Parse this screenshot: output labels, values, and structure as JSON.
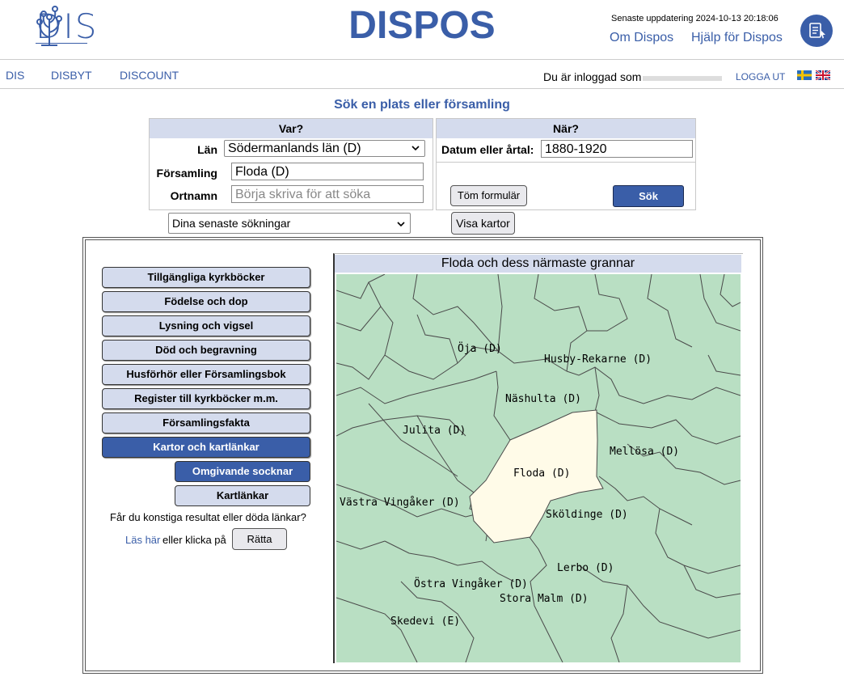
{
  "header": {
    "logo_text": "DIS",
    "title": "DISPOS",
    "updated": "Senaste uppdatering 2024-10-13 20:18:06",
    "links": [
      "Om Dispos",
      "Hjälp för Dispos"
    ]
  },
  "nav": {
    "items": [
      "DIS",
      "DISBYT",
      "DISCOUNT"
    ],
    "logged_in": "Du är inloggad som",
    "logout": "LOGGA UT"
  },
  "search": {
    "title": "Sök en plats eller församling",
    "where_head": "Var?",
    "when_head": "När?",
    "lan_label": "Län",
    "lan_value": "Södermanlands län (D)",
    "forsamling_label": "Församling",
    "forsamling_value": "Floda (D)",
    "ortnamn_label": "Ortnamn",
    "ortnamn_placeholder": "Börja skriva för att söka",
    "datum_label": "Datum eller årtal:",
    "datum_value": "1880-1920",
    "clear_btn": "Töm formulär",
    "search_btn": "Sök",
    "recent": "Dina senaste sökningar",
    "show_maps": "Visa kartor"
  },
  "sidebar": {
    "items": [
      "Tillgängliga kyrkböcker",
      "Födelse och dop",
      "Lysning och vigsel",
      "Död och begravning",
      "Husförhör eller Församlingsbok",
      "Register till kyrkböcker m.m.",
      "Församlingsfakta",
      "Kartor och kartlänkar"
    ],
    "subitems": [
      "Omgivande socknar",
      "Kartlänkar"
    ],
    "question": "Får du konstiga resultat eller döda länkar?",
    "read_here": "Läs här",
    "or_click": "eller klicka på",
    "fix_btn": "Rätta"
  },
  "map": {
    "title": "Floda och dess närmaste grannar",
    "labels": [
      "Öja (D)",
      "Husby-Rekarne (D)",
      "Näshulta (D)",
      "Julita (D)",
      "Mellösa (D)",
      "Floda (D)",
      "Västra Vingåker (D)",
      "Sköldinge (D)",
      "Lerbo (D)",
      "Östra Vingåker (D)",
      "Stora Malm (D)",
      "Skedevi (E)"
    ],
    "colors": {
      "land": "#b9dfc3",
      "selected": "#fffbe8",
      "border": "#4a4a4a"
    }
  }
}
